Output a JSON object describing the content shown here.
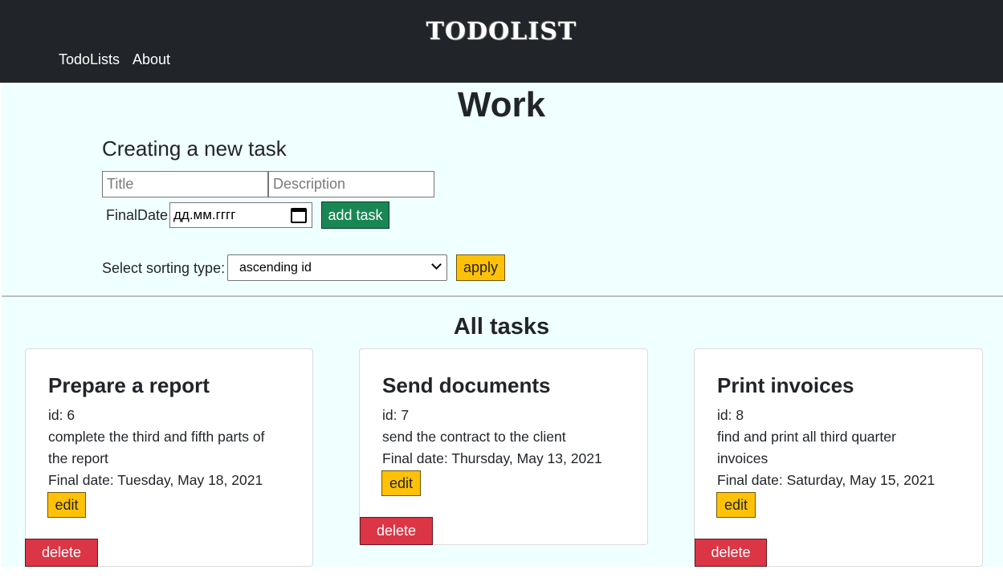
{
  "navbar": {
    "brand": "TODOLIST",
    "links": [
      {
        "label": "TodoLists"
      },
      {
        "label": "About"
      }
    ]
  },
  "list": {
    "title": "Work"
  },
  "create": {
    "heading": "Creating a new task",
    "title_placeholder": "Title",
    "description_placeholder": "Description",
    "final_date_label": "FinalDate",
    "date_value": "дд.мм.гггг",
    "add_button": "add task"
  },
  "sorting": {
    "label": "Select sorting type:",
    "selected": "ascending id",
    "apply_button": "apply"
  },
  "tasks_heading": "All tasks",
  "tasks": [
    {
      "title": "Prepare a report",
      "id_text": "id: 6",
      "description_lines": [
        "complete the third and fifth parts of",
        "the report"
      ],
      "final_date": "Final date: Tuesday, May 18, 2021",
      "edit_label": "edit",
      "delete_label": "delete"
    },
    {
      "title": "Send documents",
      "id_text": "id: 7",
      "description_lines": [
        "send the contract to the client"
      ],
      "final_date": "Final date: Thursday, May 13, 2021",
      "edit_label": "edit",
      "delete_label": "delete"
    },
    {
      "title": "Print invoices",
      "id_text": "id: 8",
      "description_lines": [
        "find and print all third quarter",
        "invoices"
      ],
      "final_date": "Final date: Saturday, May 15, 2021",
      "edit_label": "edit",
      "delete_label": "delete"
    }
  ],
  "colors": {
    "navbar": "#212529",
    "page_background": "#f0ffff",
    "success": "#198754",
    "warning": "#ffc107",
    "danger": "#dc3545"
  }
}
